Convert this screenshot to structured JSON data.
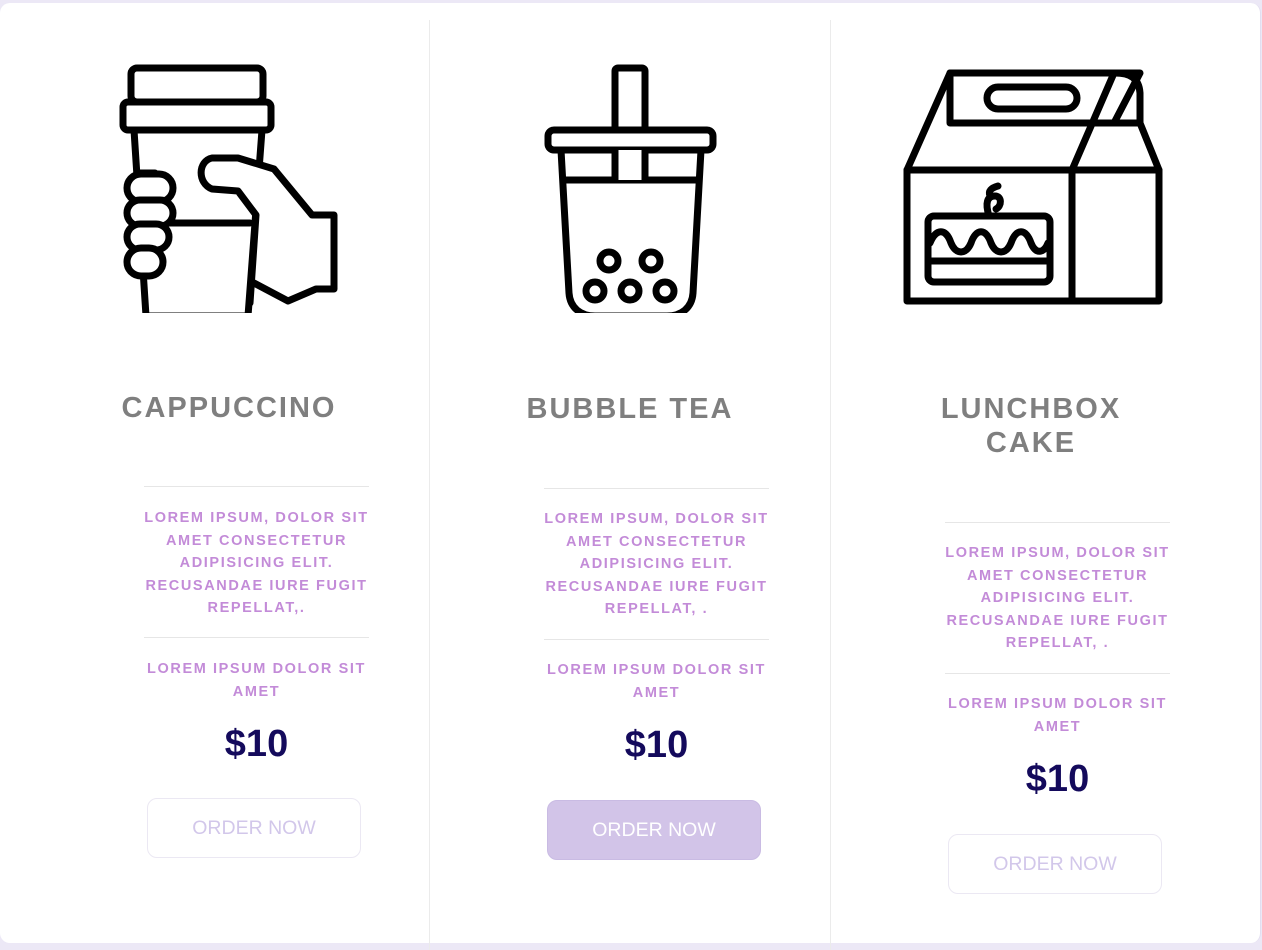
{
  "products": [
    {
      "icon": "coffee-cup-hand-icon",
      "title": "CAPPUCCINO",
      "description": "LOREM IPSUM, DOLOR SIT AMET CONSECTETUR ADIPISICING ELIT. RECUSANDAE IURE FUGIT REPELLAT,.",
      "subtitle": "LOREM IPSUM DOLOR SIT AMET",
      "price": "$10",
      "button": "ORDER NOW"
    },
    {
      "icon": "bubble-tea-icon",
      "title": "BUBBLE TEA",
      "description": "LOREM IPSUM, DOLOR SIT AMET CONSECTETUR ADIPISICING ELIT. RECUSANDAE IURE FUGIT REPELLAT, .",
      "subtitle": "LOREM IPSUM DOLOR SIT AMET",
      "price": "$10",
      "button": "ORDER NOW"
    },
    {
      "icon": "lunchbox-cake-icon",
      "title": "LUNCHBOX CAKE",
      "description": "LOREM IPSUM, DOLOR SIT AMET CONSECTETUR ADIPISICING ELIT. RECUSANDAE IURE FUGIT REPELLAT, .",
      "subtitle": "LOREM IPSUM DOLOR SIT AMET",
      "price": "$10",
      "button": "ORDER NOW"
    }
  ],
  "colors": {
    "title": "#7f7f7f",
    "accent_text": "#c38bd8",
    "price": "#140a5c",
    "button_active_bg": "#d2c4e8",
    "button_text": "#d2c7ea"
  }
}
